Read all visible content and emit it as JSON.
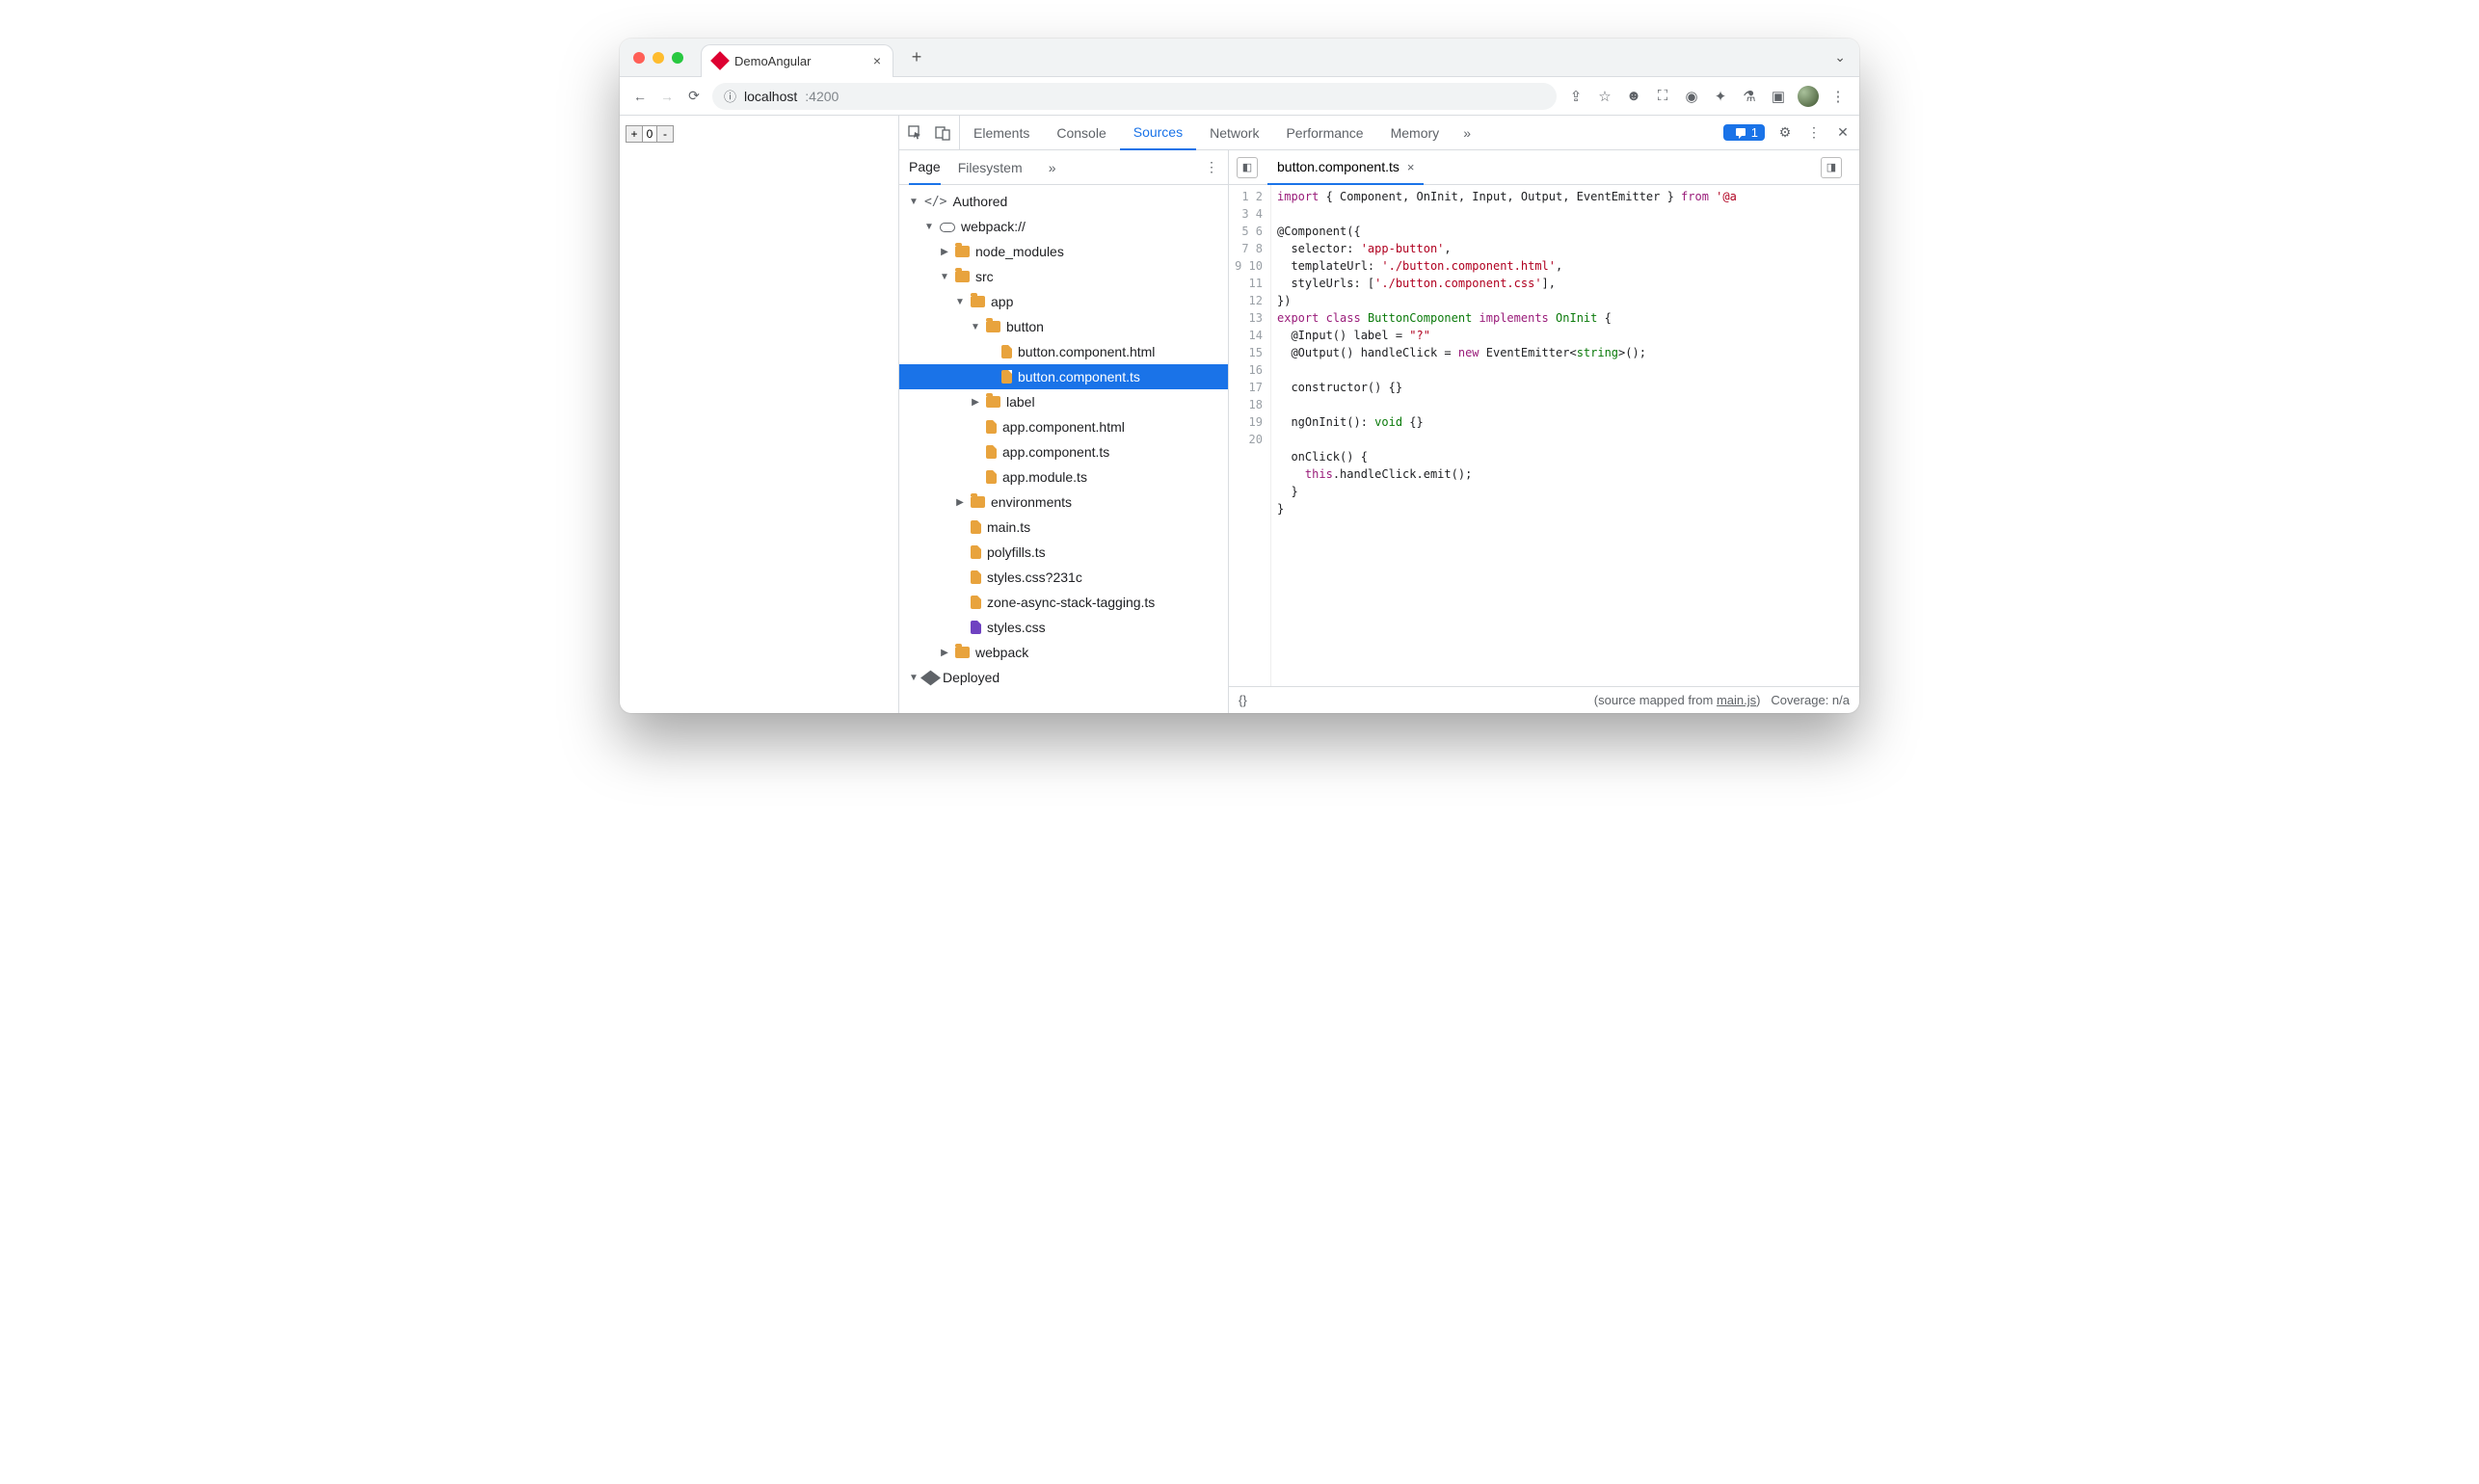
{
  "titlebar": {
    "tab_title": "DemoAngular"
  },
  "url": {
    "host": "localhost",
    "port": ":4200"
  },
  "page_buttons": {
    "plus": "+",
    "value": "0",
    "minus": "-"
  },
  "devtools_tabs": [
    "Elements",
    "Console",
    "Sources",
    "Network",
    "Performance",
    "Memory"
  ],
  "devtools_active": "Sources",
  "issues_count": "1",
  "nav_tabs": [
    "Page",
    "Filesystem"
  ],
  "nav_active": "Page",
  "tree": {
    "authored": "Authored",
    "webpack": "webpack://",
    "node_modules": "node_modules",
    "src": "src",
    "app": "app",
    "button": "button",
    "button_html": "button.component.html",
    "button_ts": "button.component.ts",
    "label": "label",
    "app_html": "app.component.html",
    "app_ts": "app.component.ts",
    "app_module": "app.module.ts",
    "environments": "environments",
    "main_ts": "main.ts",
    "polyfills": "polyfills.ts",
    "styles_hash": "styles.css?231c",
    "zone": "zone-async-stack-tagging.ts",
    "styles": "styles.css",
    "webpack_folder": "webpack",
    "deployed": "Deployed"
  },
  "editor": {
    "tab_filename": "button.component.ts",
    "line_count": 20,
    "footer_braces": "{}",
    "footer_source": "(source mapped from ",
    "footer_link": "main.js",
    "footer_close": ")",
    "footer_coverage": "Coverage: n/a"
  },
  "code": {
    "l1a": "import",
    "l1b": " { Component, OnInit, Input, Output, EventEmitter } ",
    "l1c": "from",
    "l1d": " '@a",
    "l3": "@Component({",
    "l4a": "  selector: ",
    "l4b": "'app-button'",
    "l4c": ",",
    "l5a": "  templateUrl: ",
    "l5b": "'./button.component.html'",
    "l5c": ",",
    "l6a": "  styleUrls: [",
    "l6b": "'./button.component.css'",
    "l6c": "],",
    "l7": "})",
    "l8a": "export",
    "l8b": " class",
    "l8c": " ButtonComponent",
    "l8d": " implements",
    "l8e": " OnInit",
    "l8f": " {",
    "l9a": "  @Input() label = ",
    "l9b": "\"?\"",
    "l10a": "  @Output() handleClick = ",
    "l10b": "new",
    "l10c": " EventEmitter<",
    "l10d": "string",
    "l10e": ">();",
    "l12": "  constructor() {}",
    "l14a": "  ngOnInit(): ",
    "l14b": "void",
    "l14c": " {}",
    "l16": "  onClick() {",
    "l17a": "    ",
    "l17b": "this",
    "l17c": ".handleClick.emit();",
    "l18": "  }",
    "l19": "}"
  }
}
